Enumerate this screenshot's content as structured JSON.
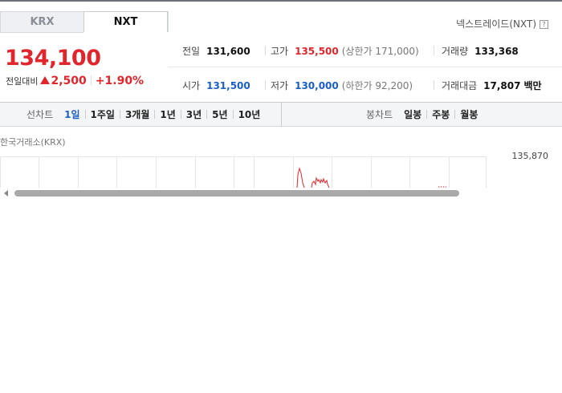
{
  "tabs": [
    {
      "label": "KRX",
      "active": false
    },
    {
      "label": "NXT",
      "active": true
    }
  ],
  "nxt_link": "넥스트레이드(NXT)",
  "help_glyph": "?",
  "price": {
    "current": "134,100",
    "change_label": "전일대비",
    "change_value": "2,500",
    "change_percent": "+1.90%",
    "direction": "up"
  },
  "stats": {
    "prev_close": {
      "label": "전일",
      "value": "131,600"
    },
    "high": {
      "label": "고가",
      "value": "135,500",
      "limit_label": "(상한가",
      "limit_value": "171,000)"
    },
    "volume": {
      "label": "거래량",
      "value": "133,368"
    },
    "open": {
      "label": "시가",
      "value": "131,500"
    },
    "low": {
      "label": "저가",
      "value": "130,000",
      "limit_label": "(하한가",
      "limit_value": "92,200)"
    },
    "amount": {
      "label": "거래대금",
      "value": "17,807",
      "unit": "백만"
    }
  },
  "toolbar": {
    "line_label": "선차트",
    "line_periods": [
      "1일",
      "1주일",
      "3개월",
      "1년",
      "3년",
      "5년",
      "10년"
    ],
    "active_period": "1일",
    "candle_label": "봉차트",
    "candle_periods": [
      "일봉",
      "주봉",
      "월봉"
    ]
  },
  "chart": {
    "market_label": "한국거래소(KRX)",
    "y_tick": "135,870"
  },
  "colors": {
    "up": "#e0262c",
    "down": "#1a5fc4",
    "active": "#1a5fc4"
  }
}
